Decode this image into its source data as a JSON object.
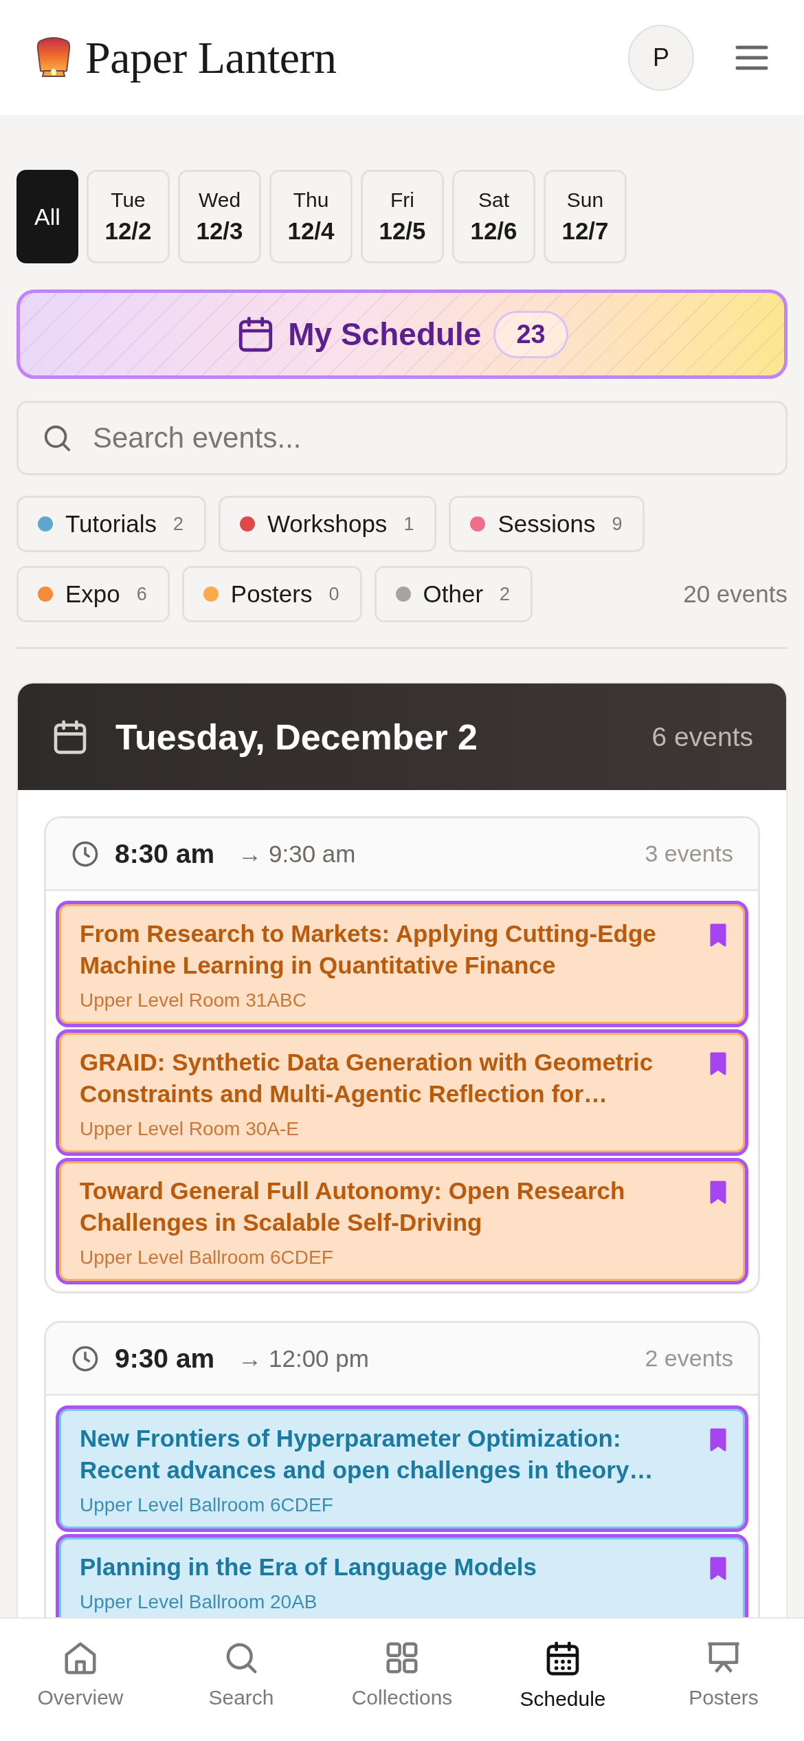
{
  "header": {
    "brand": "Paper Lantern",
    "avatar": "P"
  },
  "days": [
    {
      "kind": "all",
      "label": "All",
      "selected": true
    },
    {
      "kind": "day",
      "weekday": "Tue",
      "date": "12/2",
      "selected": false
    },
    {
      "kind": "day",
      "weekday": "Wed",
      "date": "12/3",
      "selected": false
    },
    {
      "kind": "day",
      "weekday": "Thu",
      "date": "12/4",
      "selected": false
    },
    {
      "kind": "day",
      "weekday": "Fri",
      "date": "12/5",
      "selected": false
    },
    {
      "kind": "day",
      "weekday": "Sat",
      "date": "12/6",
      "selected": false
    },
    {
      "kind": "day",
      "weekday": "Sun",
      "date": "12/7",
      "selected": false
    }
  ],
  "my_schedule": {
    "label": "My Schedule",
    "count": "23"
  },
  "search": {
    "placeholder": "Search events..."
  },
  "filters": [
    {
      "label": "Tutorials",
      "count": "2",
      "color": "#5ba8d0"
    },
    {
      "label": "Workshops",
      "count": "1",
      "color": "#e04848"
    },
    {
      "label": "Sessions",
      "count": "9",
      "color": "#ef6f8a"
    },
    {
      "label": "Expo",
      "count": "6",
      "color": "#f48c3a"
    },
    {
      "label": "Posters",
      "count": "0",
      "color": "#fbaa4c"
    },
    {
      "label": "Other",
      "count": "2",
      "color": "#aaa29c"
    }
  ],
  "event_total": "20 events",
  "day": {
    "title": "Tuesday, December 2",
    "count": "6 events",
    "slots": [
      {
        "start": "8:30 am",
        "end": "→ 9:30 am",
        "count": "3 events",
        "events": [
          {
            "kind": "expo",
            "title": "From Research to Markets: Applying Cutting-Edge Machine Learning in Quantitative Finance",
            "location": "Upper Level Room 31ABC",
            "bookmarked": true
          },
          {
            "kind": "expo",
            "title": "GRAID: Synthetic Data Generation with Geometric Constraints and Multi-Agentic Reflection for…",
            "location": "Upper Level Room 30A-E",
            "bookmarked": true
          },
          {
            "kind": "expo",
            "title": "Toward General Full Autonomy: Open Research Challenges in Scalable Self-Driving",
            "location": "Upper Level Ballroom 6CDEF",
            "bookmarked": true
          }
        ]
      },
      {
        "start": "9:30 am",
        "end": "→ 12:00 pm",
        "count": "2 events",
        "events": [
          {
            "kind": "tutorial",
            "title": "New Frontiers of Hyperparameter Optimization: Recent advances and open challenges in theory…",
            "location": "Upper Level Ballroom 6CDEF",
            "bookmarked": true
          },
          {
            "kind": "tutorial",
            "title": "Planning in the Era of Language Models",
            "location": "Upper Level Ballroom 20AB",
            "bookmarked": true
          }
        ]
      }
    ]
  },
  "nav": [
    {
      "label": "Overview",
      "selected": false
    },
    {
      "label": "Search",
      "selected": false
    },
    {
      "label": "Collections",
      "selected": false
    },
    {
      "label": "Schedule",
      "selected": true
    },
    {
      "label": "Posters",
      "selected": false
    }
  ]
}
